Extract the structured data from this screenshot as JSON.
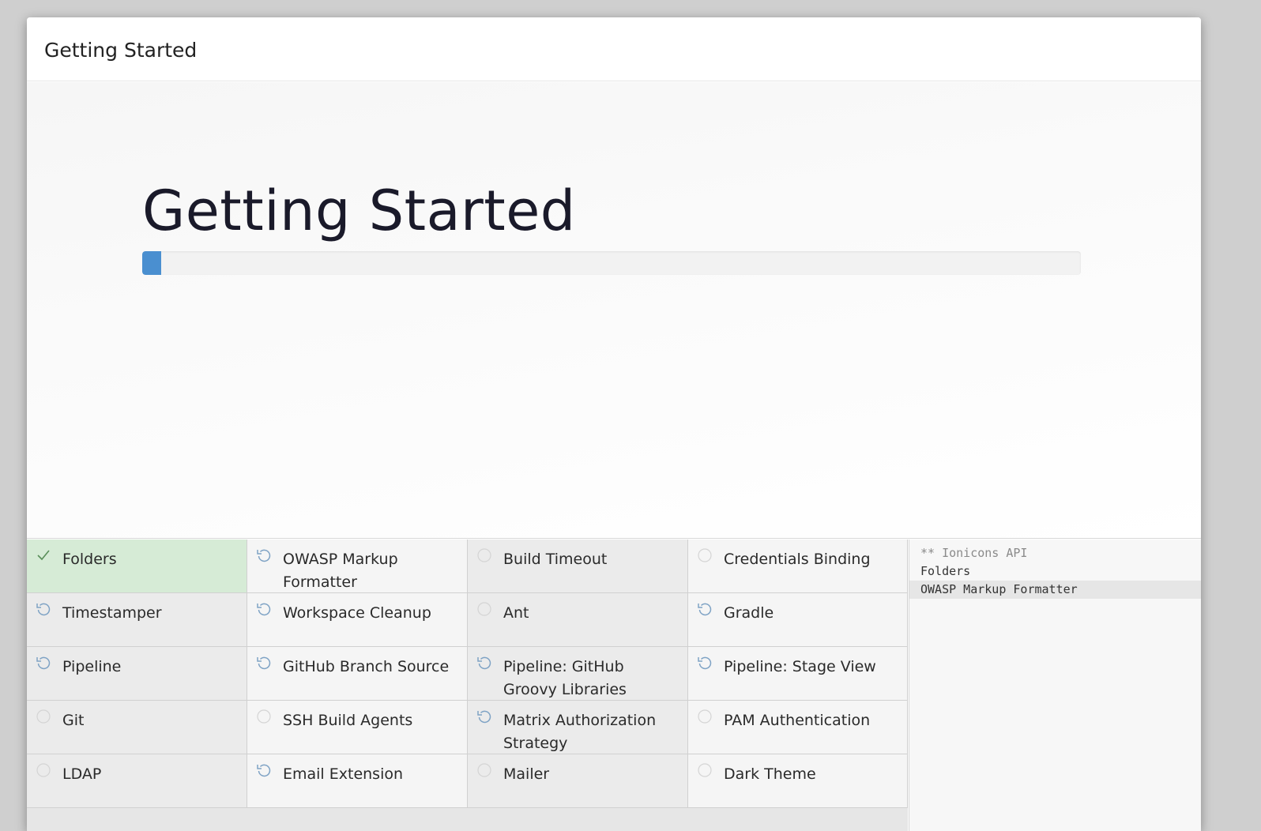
{
  "dialog": {
    "title": "Getting Started"
  },
  "hero": {
    "title": "Getting Started",
    "progress_fraction": 0.02,
    "progress_color": "#4a8fd0"
  },
  "colors": {
    "success_bg": "#d6ebd6",
    "progress": "#4a8fd0",
    "icon": "#7fa3c5",
    "check": "#5a8f5a"
  },
  "plugins": [
    {
      "label": "Folders",
      "status": "success",
      "icon": "check-icon"
    },
    {
      "label": "OWASP Markup Formatter",
      "status": "installing",
      "icon": "refresh-icon"
    },
    {
      "label": "Build Timeout",
      "status": "pending",
      "icon": "circle-icon"
    },
    {
      "label": "Credentials Binding",
      "status": "pending",
      "icon": "circle-icon"
    },
    {
      "label": "Timestamper",
      "status": "installing",
      "icon": "refresh-icon"
    },
    {
      "label": "Workspace Cleanup",
      "status": "installing",
      "icon": "refresh-icon"
    },
    {
      "label": "Ant",
      "status": "pending",
      "icon": "circle-icon"
    },
    {
      "label": "Gradle",
      "status": "installing",
      "icon": "refresh-icon"
    },
    {
      "label": "Pipeline",
      "status": "installing",
      "icon": "refresh-icon"
    },
    {
      "label": "GitHub Branch Source",
      "status": "installing",
      "icon": "refresh-icon"
    },
    {
      "label": "Pipeline: GitHub Groovy Libraries",
      "status": "installing",
      "icon": "refresh-icon"
    },
    {
      "label": "Pipeline: Stage View",
      "status": "installing",
      "icon": "refresh-icon"
    },
    {
      "label": "Git",
      "status": "pending",
      "icon": "circle-icon"
    },
    {
      "label": "SSH Build Agents",
      "status": "pending",
      "icon": "circle-icon"
    },
    {
      "label": "Matrix Authorization Strategy",
      "status": "installing",
      "icon": "refresh-icon"
    },
    {
      "label": "PAM Authentication",
      "status": "pending",
      "icon": "circle-icon"
    },
    {
      "label": "LDAP",
      "status": "pending",
      "icon": "circle-icon"
    },
    {
      "label": "Email Extension",
      "status": "installing",
      "icon": "refresh-icon"
    },
    {
      "label": "Mailer",
      "status": "pending",
      "icon": "circle-icon"
    },
    {
      "label": "Dark Theme",
      "status": "pending",
      "icon": "circle-icon"
    }
  ],
  "log": {
    "lines": [
      {
        "text": "** Ionicons API",
        "style": "dep"
      },
      {
        "text": "Folders",
        "style": "normal"
      },
      {
        "text": "OWASP Markup Formatter",
        "style": "active"
      }
    ]
  }
}
